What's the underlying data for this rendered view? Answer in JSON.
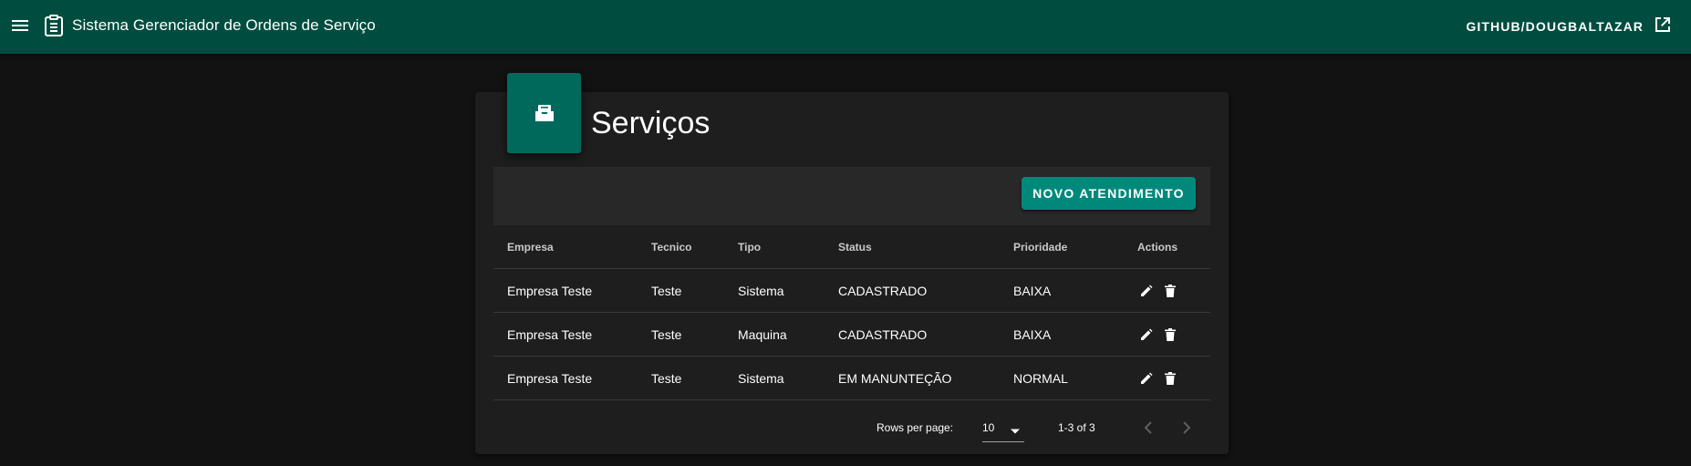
{
  "appbar": {
    "title": "Sistema Gerenciador de Ordens de Serviço",
    "github_label": "GITHUB/DOUGBALTAZAR",
    "background": "#004d40"
  },
  "card": {
    "title": "Serviços",
    "avatar_icon": "inbox-tray-icon",
    "accent": "#00695c"
  },
  "toolbar": {
    "new_button_label": "NOVO ATENDIMENTO",
    "button_color": "#00897b"
  },
  "table": {
    "columns": [
      "Empresa",
      "Tecnico",
      "Tipo",
      "Status",
      "Prioridade",
      "Actions"
    ],
    "rows": [
      [
        "Empresa Teste",
        "Teste",
        "Sistema",
        "CADASTRADO",
        "BAIXA"
      ],
      [
        "Empresa Teste",
        "Teste",
        "Maquina",
        "CADASTRADO",
        "BAIXA"
      ],
      [
        "Empresa Teste",
        "Teste",
        "Sistema",
        "EM MANUNTEÇÃO",
        "NORMAL"
      ]
    ],
    "row_action_icons": [
      "pencil-icon",
      "trash-icon"
    ]
  },
  "pagination": {
    "rows_per_page_label": "Rows per page:",
    "rows_per_page_value": "10",
    "range_text": "1-3 of 3"
  }
}
